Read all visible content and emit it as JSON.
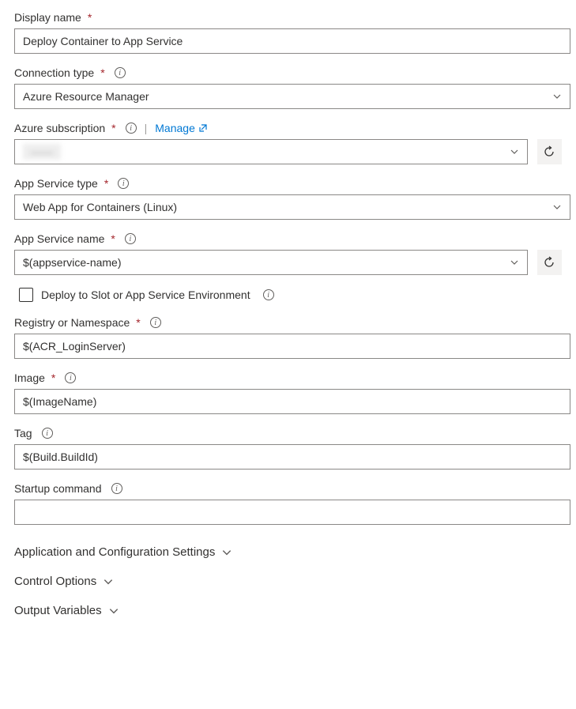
{
  "labels": {
    "displayName": "Display name",
    "connectionType": "Connection type",
    "azureSubscription": "Azure subscription",
    "manage": "Manage",
    "appServiceType": "App Service type",
    "appServiceName": "App Service name",
    "deploySlot": "Deploy to Slot or App Service Environment",
    "registry": "Registry or Namespace",
    "image": "Image",
    "tag": "Tag",
    "startupCommand": "Startup command"
  },
  "values": {
    "displayName": "Deploy Container to App Service",
    "connectionType": "Azure Resource Manager",
    "azureSubscription": "——",
    "appServiceType": "Web App for Containers (Linux)",
    "appServiceName": "$(appservice-name)",
    "registry": "$(ACR_LoginServer)",
    "image": "$(ImageName)",
    "tag": "$(Build.BuildId)",
    "startupCommand": ""
  },
  "sections": {
    "appConfig": "Application and Configuration Settings",
    "controlOptions": "Control Options",
    "outputVariables": "Output Variables"
  }
}
